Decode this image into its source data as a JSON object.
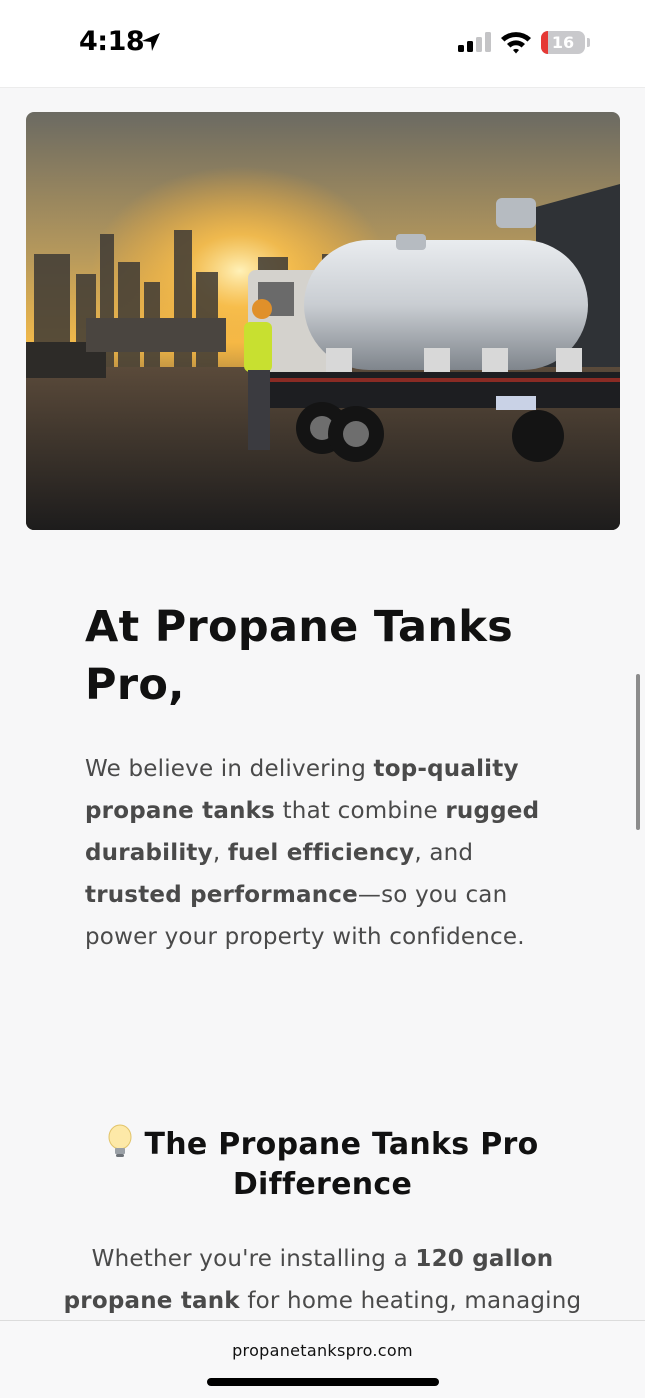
{
  "status_bar": {
    "time": "4:18",
    "battery_percent": "16",
    "battery_level": 0.16,
    "location_icon": "location-arrow-icon",
    "signal_icon": "cellular-signal-icon",
    "wifi_icon": "wifi-icon"
  },
  "hero": {
    "icon": "hero-image"
  },
  "main": {
    "heading": "At Propane Tanks Pro,",
    "intro": {
      "p1": "We believe in delivering ",
      "b1": "top-quality propane tanks",
      "p2": " that combine ",
      "b2": "rugged durability",
      "p3": ", ",
      "b3": "fuel efficiency",
      "p4": ", and ",
      "b4": "trusted performance",
      "p5": "—so you can power your property with confidence."
    },
    "difference_heading": "The Propane Tanks Pro Difference",
    "difference_icon": "lightbulb-icon",
    "difference": {
      "p1": "Whether you're installing a ",
      "b1": "120 gallon propane tank",
      "p2": " for home heating, managing"
    }
  },
  "browser": {
    "url": "propanetankspro.com"
  },
  "colors": {
    "background": "#f7f7f8",
    "text": "#111111",
    "body_text": "#4a4a4a",
    "battery_low": "#e53935"
  }
}
